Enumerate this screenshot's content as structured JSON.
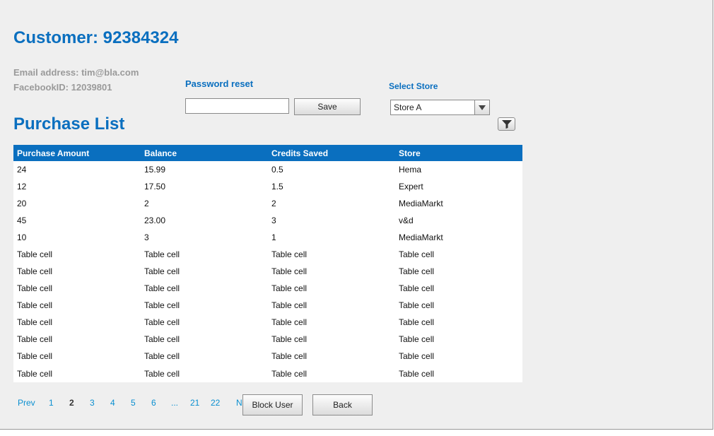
{
  "customer": {
    "title": "Customer: 92384324",
    "email": "Email address: tim@bla.com",
    "facebook": "FacebookID: 12039801"
  },
  "password_reset": {
    "label": "Password reset",
    "value": "",
    "save_label": "Save"
  },
  "store_select": {
    "label": "Select Store",
    "selected": "Store A",
    "arrow_icon": "chevron-down-icon"
  },
  "purchase_list": {
    "title": "Purchase List",
    "filter_icon": "funnel-icon",
    "columns": [
      "Purchase Amount",
      "Balance",
      "Credits Saved",
      "Store"
    ],
    "rows": [
      [
        "24",
        "15.99",
        "0.5",
        "Hema"
      ],
      [
        "12",
        "17.50",
        "1.5",
        "Expert"
      ],
      [
        "20",
        "2",
        "2",
        "MediaMarkt"
      ],
      [
        "45",
        "23.00",
        "3",
        "v&d"
      ],
      [
        "10",
        "3",
        "1",
        "MediaMarkt"
      ],
      [
        "Table cell",
        "Table cell",
        "Table cell",
        "Table cell"
      ],
      [
        "Table cell",
        "Table cell",
        "Table cell",
        "Table cell"
      ],
      [
        "Table cell",
        "Table cell",
        "Table cell",
        "Table cell"
      ],
      [
        "Table cell",
        "Table cell",
        "Table cell",
        "Table cell"
      ],
      [
        "Table cell",
        "Table cell",
        "Table cell",
        "Table cell"
      ],
      [
        "Table cell",
        "Table cell",
        "Table cell",
        "Table cell"
      ],
      [
        "Table cell",
        "Table cell",
        "Table cell",
        "Table cell"
      ],
      [
        "Table cell",
        "Table cell",
        "Table cell",
        "Table cell"
      ]
    ]
  },
  "pagination": {
    "items": [
      "Prev",
      "1",
      "2",
      "3",
      "4",
      "5",
      "6",
      "...",
      "21",
      "22",
      "Next"
    ],
    "current": "2"
  },
  "actions": {
    "block_label": "Block User",
    "back_label": "Back"
  },
  "colors": {
    "accent": "#0a6fbf",
    "link": "#0a8fd0",
    "background": "#efefef"
  }
}
